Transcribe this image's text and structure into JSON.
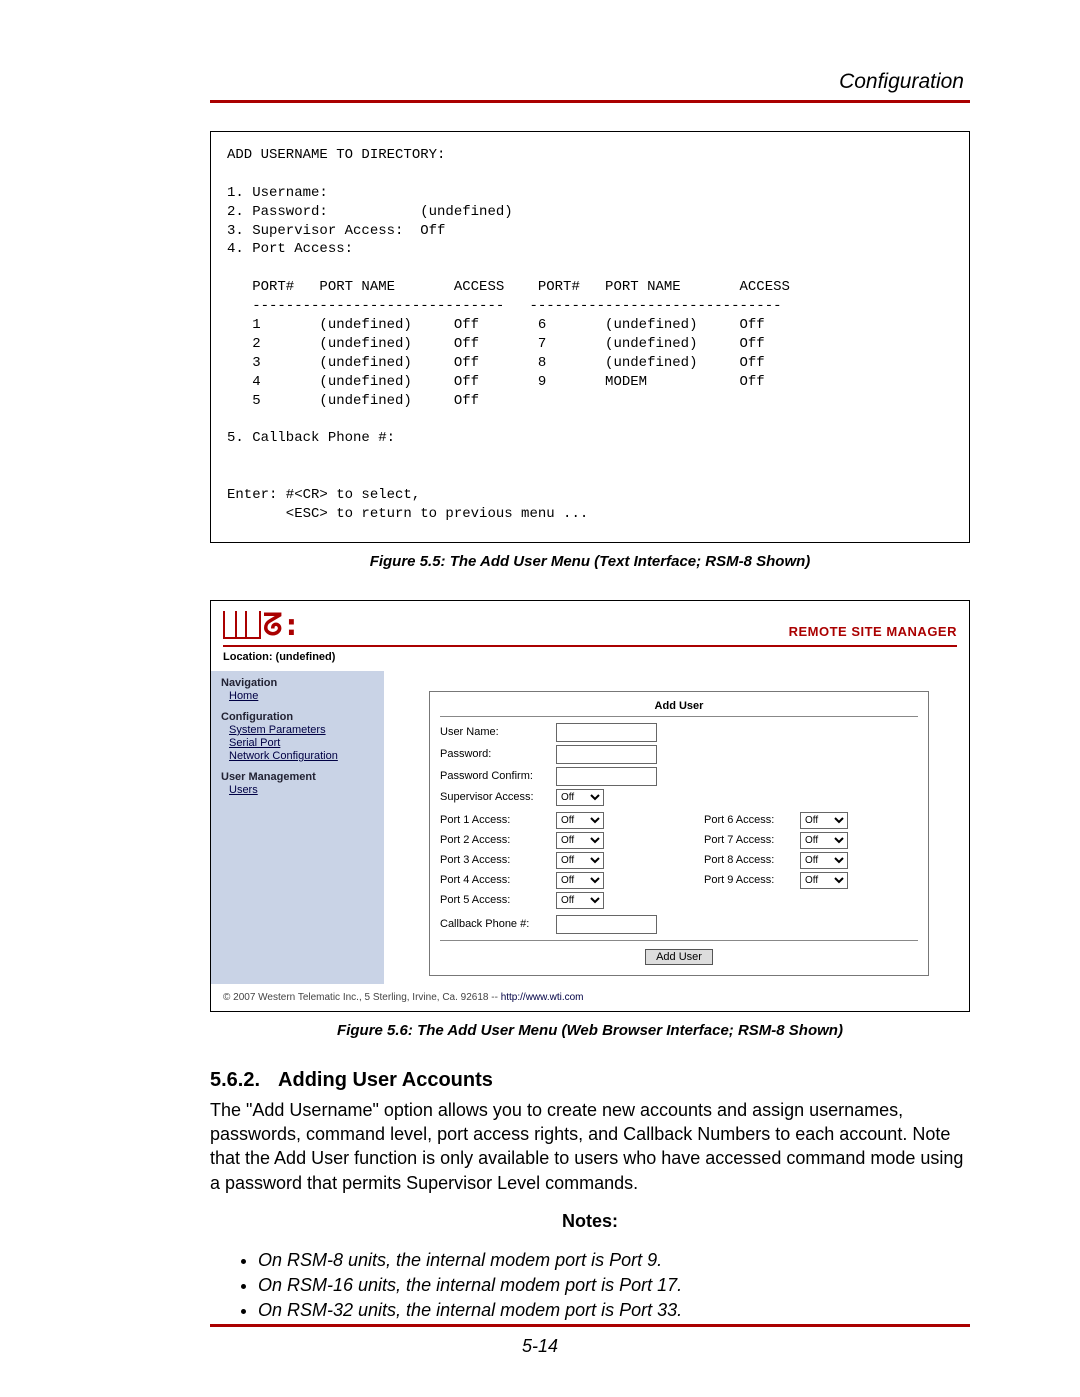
{
  "header": {
    "title": "Configuration"
  },
  "terminal": {
    "content": "ADD USERNAME TO DIRECTORY:\n\n1. Username:\n2. Password:           (undefined)\n3. Supervisor Access:  Off\n4. Port Access:\n\n   PORT#   PORT NAME       ACCESS    PORT#   PORT NAME       ACCESS\n   ------------------------------   ------------------------------\n   1       (undefined)     Off       6       (undefined)     Off\n   2       (undefined)     Off       7       (undefined)     Off\n   3       (undefined)     Off       8       (undefined)     Off\n   4       (undefined)     Off       9       MODEM           Off\n   5       (undefined)     Off\n\n5. Callback Phone #:\n\n\nEnter: #<CR> to select,\n       <ESC> to return to previous menu ..."
  },
  "figcap1": "Figure 5.5:  The Add User Menu (Text Interface; RSM-8 Shown)",
  "web": {
    "rsm": "REMOTE SITE MANAGER",
    "location": "Location: (undefined)",
    "nav": {
      "h1": "Navigation",
      "home": "Home",
      "h2": "Configuration",
      "sys": "System Parameters",
      "ser": "Serial Port",
      "net": "Network Configuration",
      "h3": "User Management",
      "users": "Users"
    },
    "form": {
      "title": "Add User",
      "un": "User Name:",
      "pw": "Password:",
      "pc": "Password Confirm:",
      "sa": "Supervisor Access:",
      "left": [
        {
          "l": "Port 1 Access:",
          "v": "Off"
        },
        {
          "l": "Port 2 Access:",
          "v": "Off"
        },
        {
          "l": "Port 3 Access:",
          "v": "Off"
        },
        {
          "l": "Port 4 Access:",
          "v": "Off"
        },
        {
          "l": "Port 5 Access:",
          "v": "Off"
        }
      ],
      "right": [
        {
          "l": "Port 6 Access:",
          "v": "Off"
        },
        {
          "l": "Port 7 Access:",
          "v": "Off"
        },
        {
          "l": "Port 8 Access:",
          "v": "Off"
        },
        {
          "l": "Port 9 Access:",
          "v": "Off"
        }
      ],
      "cb": "Callback Phone #:",
      "btn": "Add User",
      "sa_val": "Off"
    },
    "copy": "© 2007 Western Telematic Inc., 5 Sterling, Irvine, Ca. 92618 -- ",
    "link": "http://www.wti.com"
  },
  "figcap2": "Figure 5.6:  The Add User Menu (Web Browser Interface; RSM-8 Shown)",
  "section": {
    "num": "5.6.2.",
    "title": "Adding User Accounts",
    "body": "The \"Add Username\" option allows you to create new accounts and assign usernames, passwords, command level, port access rights, and Callback Numbers to each account. Note that the Add User function is only available to users who have accessed command mode using a password that permits Supervisor Level commands."
  },
  "notes": {
    "h": "Notes:",
    "items": [
      "On RSM-8 units, the internal modem port is Port 9.",
      "On RSM-16 units, the internal modem port is Port 17.",
      "On RSM-32 units, the internal modem port is Port 33."
    ]
  },
  "pagenum": "5-14"
}
